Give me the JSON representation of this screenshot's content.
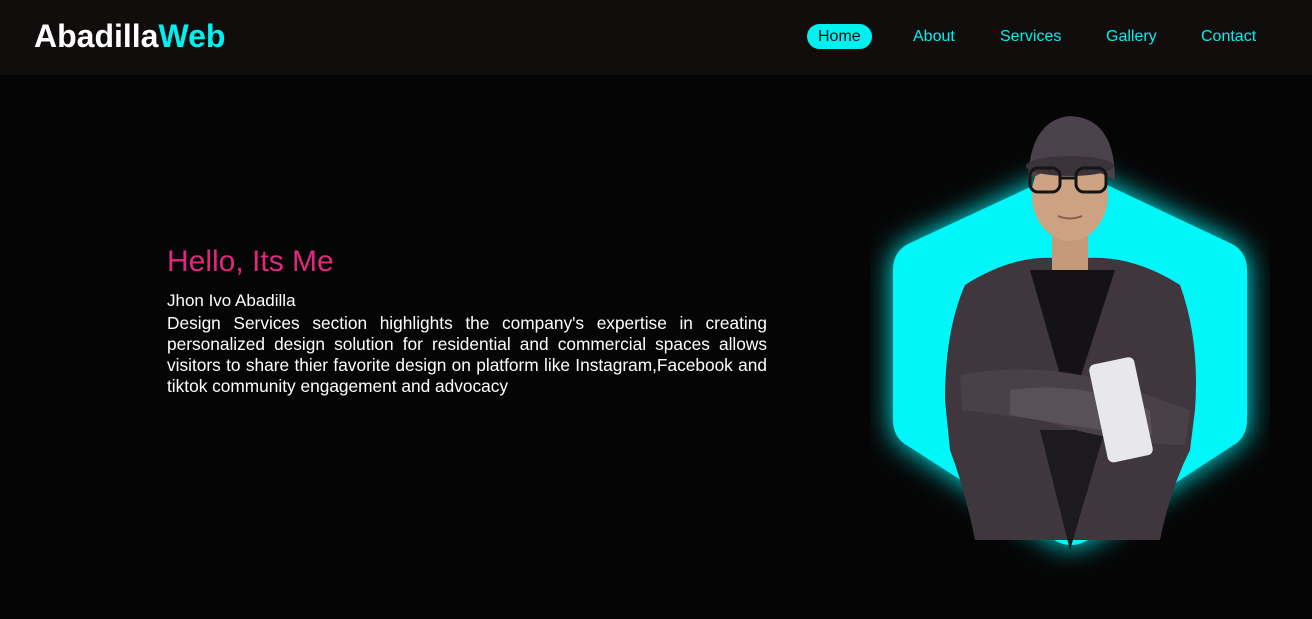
{
  "header": {
    "logo_primary": "Abadilla",
    "logo_accent": "Web",
    "nav": [
      {
        "label": "Home",
        "active": true
      },
      {
        "label": "About",
        "active": false
      },
      {
        "label": "Services",
        "active": false
      },
      {
        "label": "Gallery",
        "active": false
      },
      {
        "label": "Contact",
        "active": false
      }
    ]
  },
  "hero": {
    "greeting": "Hello, Its Me",
    "name": "Jhon Ivo Abadilla",
    "description": "Design Services section highlights the company's expertise in creating personalized design solution for residential and commercial spaces allows visitors to share thier favorite design on platform like Instagram,Facebook and tiktok community engagement and advocacy"
  },
  "colors": {
    "accent": "#00f0f0",
    "greeting": "#e0287f",
    "header_bg": "#110d0c",
    "page_bg": "#050505"
  },
  "portrait": {
    "shape": "hexagon",
    "subject": "man-in-cap-and-glasses-arms-crossed"
  }
}
